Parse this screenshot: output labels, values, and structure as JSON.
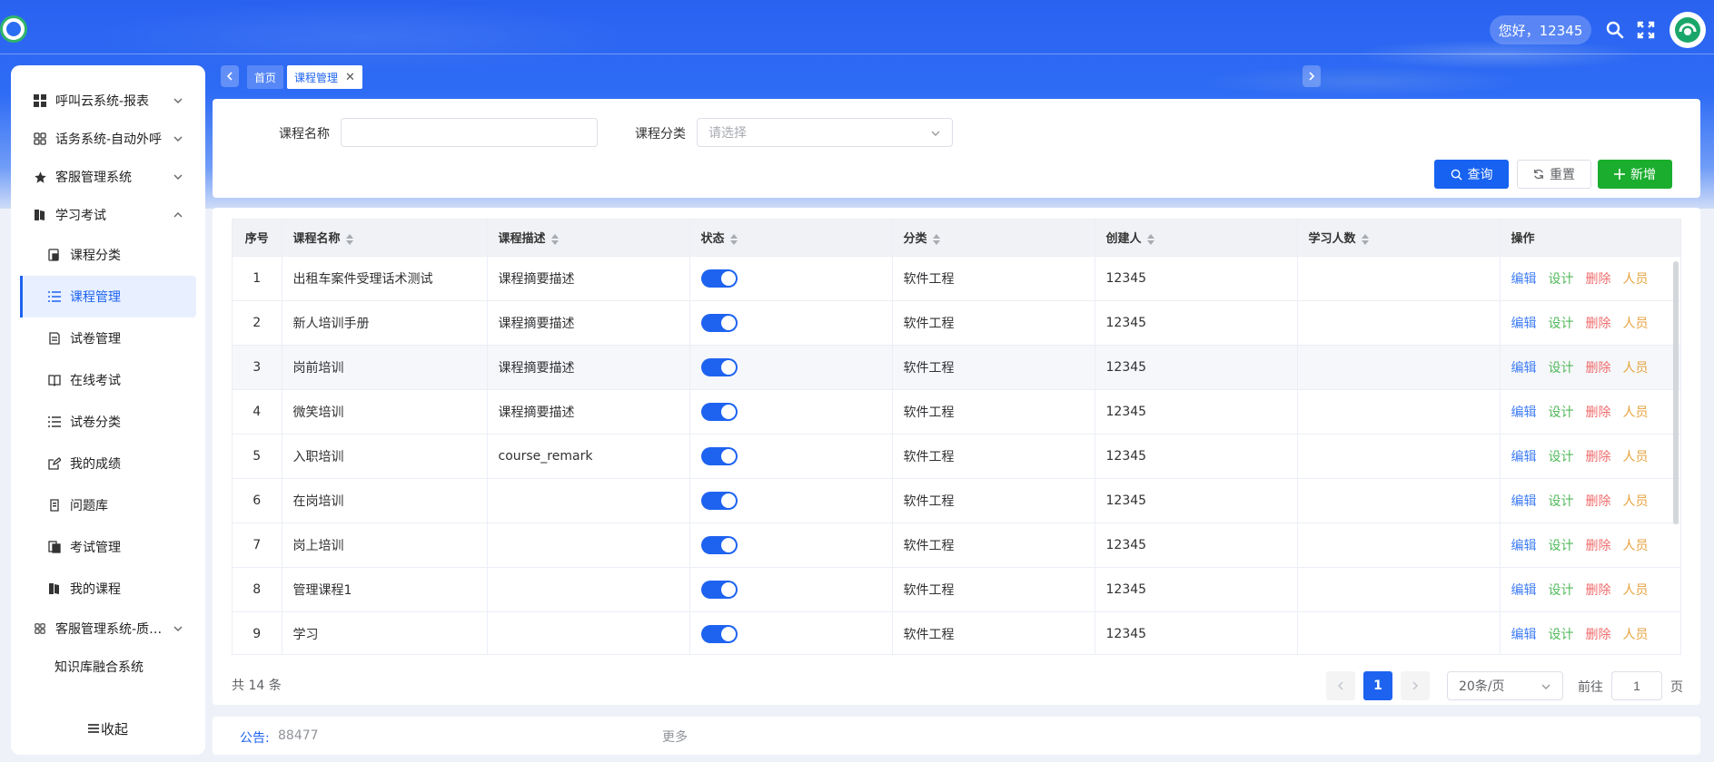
{
  "header": {
    "greeting": "您好，12345",
    "icons": [
      "search-icon",
      "fullscreen-icon",
      "avatar"
    ],
    "colors": {
      "primary": "#1e63f0",
      "success": "#1aad2e",
      "danger": "#f06c6c",
      "warning": "#e6a23c"
    }
  },
  "sidebar": {
    "items": [
      {
        "label": "呼叫云系统-报表",
        "icon": "grid-icon",
        "expandable": true
      },
      {
        "label": "话务系统-自动外呼",
        "icon": "apps-icon",
        "expandable": true
      },
      {
        "label": "客服管理系统",
        "icon": "star-icon",
        "expandable": true
      },
      {
        "label": "学习考试",
        "icon": "book-icon",
        "expandable": true,
        "expanded": true
      }
    ],
    "sub_items": [
      {
        "label": "课程分类",
        "icon": "course-category-icon"
      },
      {
        "label": "课程管理",
        "icon": "list-icon",
        "active": true
      },
      {
        "label": "试卷管理",
        "icon": "paper-icon"
      },
      {
        "label": "在线考试",
        "icon": "open-book-icon"
      },
      {
        "label": "试卷分类",
        "icon": "list-icon"
      },
      {
        "label": "我的成绩",
        "icon": "edit-icon"
      },
      {
        "label": "问题库",
        "icon": "question-bank-icon"
      },
      {
        "label": "考试管理",
        "icon": "exam-manage-icon"
      },
      {
        "label": "我的课程",
        "icon": "book-icon"
      }
    ],
    "bottom_items": [
      {
        "label": "客服管理系统-质检管理",
        "icon": "apps-icon",
        "expandable": true
      },
      {
        "label": "知识库融合系统"
      }
    ],
    "collapse_label": "收起"
  },
  "tabs": {
    "home": "首页",
    "current": "课程管理"
  },
  "filter": {
    "course_name_label": "课程名称",
    "course_name_value": "",
    "category_label": "课程分类",
    "category_placeholder": "请选择",
    "query_label": "查询",
    "reset_label": "重置",
    "add_label": "新增"
  },
  "table": {
    "columns": [
      "序号",
      "课程名称",
      "课程描述",
      "状态",
      "分类",
      "创建人",
      "学习人数",
      "操作"
    ],
    "rows": [
      {
        "index": "1",
        "name": "出租车案件受理话术测试",
        "desc": "课程摘要描述",
        "status": true,
        "category": "软件工程",
        "creator": "12345",
        "learners": ""
      },
      {
        "index": "2",
        "name": "新人培训手册",
        "desc": "课程摘要描述",
        "status": true,
        "category": "软件工程",
        "creator": "12345",
        "learners": ""
      },
      {
        "index": "3",
        "name": "岗前培训",
        "desc": "课程摘要描述",
        "status": true,
        "category": "软件工程",
        "creator": "12345",
        "learners": ""
      },
      {
        "index": "4",
        "name": "微笑培训",
        "desc": "课程摘要描述",
        "status": true,
        "category": "软件工程",
        "creator": "12345",
        "learners": ""
      },
      {
        "index": "5",
        "name": "入职培训",
        "desc": "course_remark",
        "status": true,
        "category": "软件工程",
        "creator": "12345",
        "learners": ""
      },
      {
        "index": "6",
        "name": "在岗培训",
        "desc": "",
        "status": true,
        "category": "软件工程",
        "creator": "12345",
        "learners": ""
      },
      {
        "index": "7",
        "name": "岗上培训",
        "desc": "",
        "status": true,
        "category": "软件工程",
        "creator": "12345",
        "learners": ""
      },
      {
        "index": "8",
        "name": "管理课程1",
        "desc": "",
        "status": true,
        "category": "软件工程",
        "creator": "12345",
        "learners": ""
      },
      {
        "index": "9",
        "name": "学习",
        "desc": "",
        "status": true,
        "category": "软件工程",
        "creator": "12345",
        "learners": ""
      }
    ],
    "actions": {
      "edit": "编辑",
      "design": "设计",
      "delete": "删除",
      "people": "人员"
    }
  },
  "pagination": {
    "total": "共 14 条",
    "current_page": "1",
    "page_size": "20条/页",
    "goto_label": "前往",
    "goto_value": "1",
    "page_unit": "页"
  },
  "notice": {
    "label": "公告:",
    "value": "88477",
    "more": "更多"
  }
}
